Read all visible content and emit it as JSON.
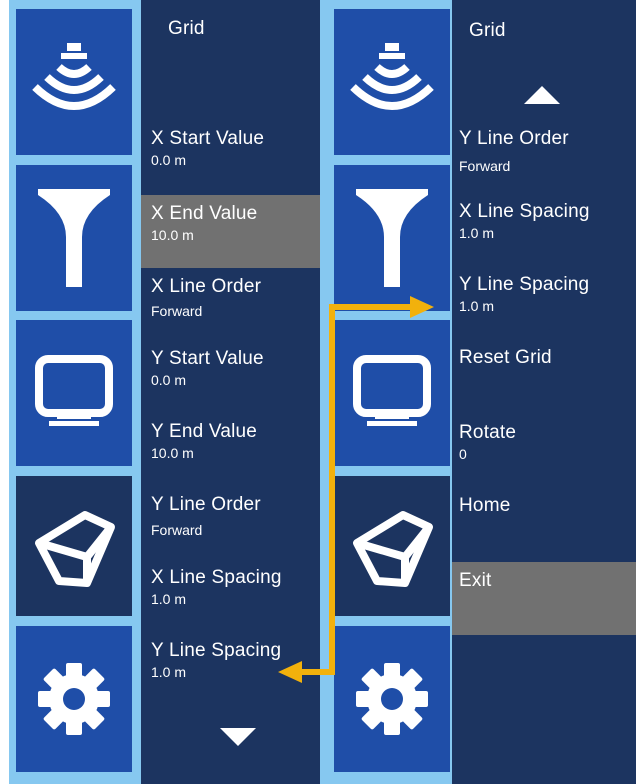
{
  "colors": {
    "frame": "#86c8f0",
    "icon_tile_bright": "#1f4ea8",
    "icon_tile_dark": "#1c3460",
    "menu_background": "#1c3460",
    "selected_item": "#717171",
    "text": "#ffffff",
    "connector_arrow": "#f2b10c"
  },
  "left_panel": {
    "title": "Grid",
    "icons": [
      "sonar-icon",
      "filter-icon",
      "monitor-icon",
      "cube-icon",
      "gear-icon"
    ],
    "items": [
      {
        "label": "X Start Value",
        "value": "0.0 m"
      },
      {
        "label": "X End Value",
        "value": "10.0 m",
        "selected": true
      },
      {
        "label": "X Line Order",
        "value": "Forward"
      },
      {
        "label": "Y Start Value",
        "value": "0.0 m"
      },
      {
        "label": "Y End Value",
        "value": "10.0 m"
      },
      {
        "label": "Y Line Order",
        "value": "Forward"
      },
      {
        "label": "X Line Spacing",
        "value": "1.0 m"
      },
      {
        "label": "Y Line Spacing",
        "value": "1.0 m"
      }
    ],
    "scroll": "down-arrow"
  },
  "right_panel": {
    "title": "Grid",
    "icons": [
      "sonar-icon",
      "filter-icon",
      "monitor-icon",
      "cube-icon",
      "gear-icon"
    ],
    "scroll": "up-arrow",
    "items": [
      {
        "label": "Y Line Order",
        "value": "Forward"
      },
      {
        "label": "X Line Spacing",
        "value": "1.0 m"
      },
      {
        "label": "Y Line Spacing",
        "value": "1.0 m"
      },
      {
        "label": "Reset Grid",
        "value": ""
      },
      {
        "label": "Rotate",
        "value": "0"
      },
      {
        "label": "Home",
        "value": ""
      },
      {
        "label": "Exit",
        "value": "",
        "selected": true
      }
    ]
  }
}
